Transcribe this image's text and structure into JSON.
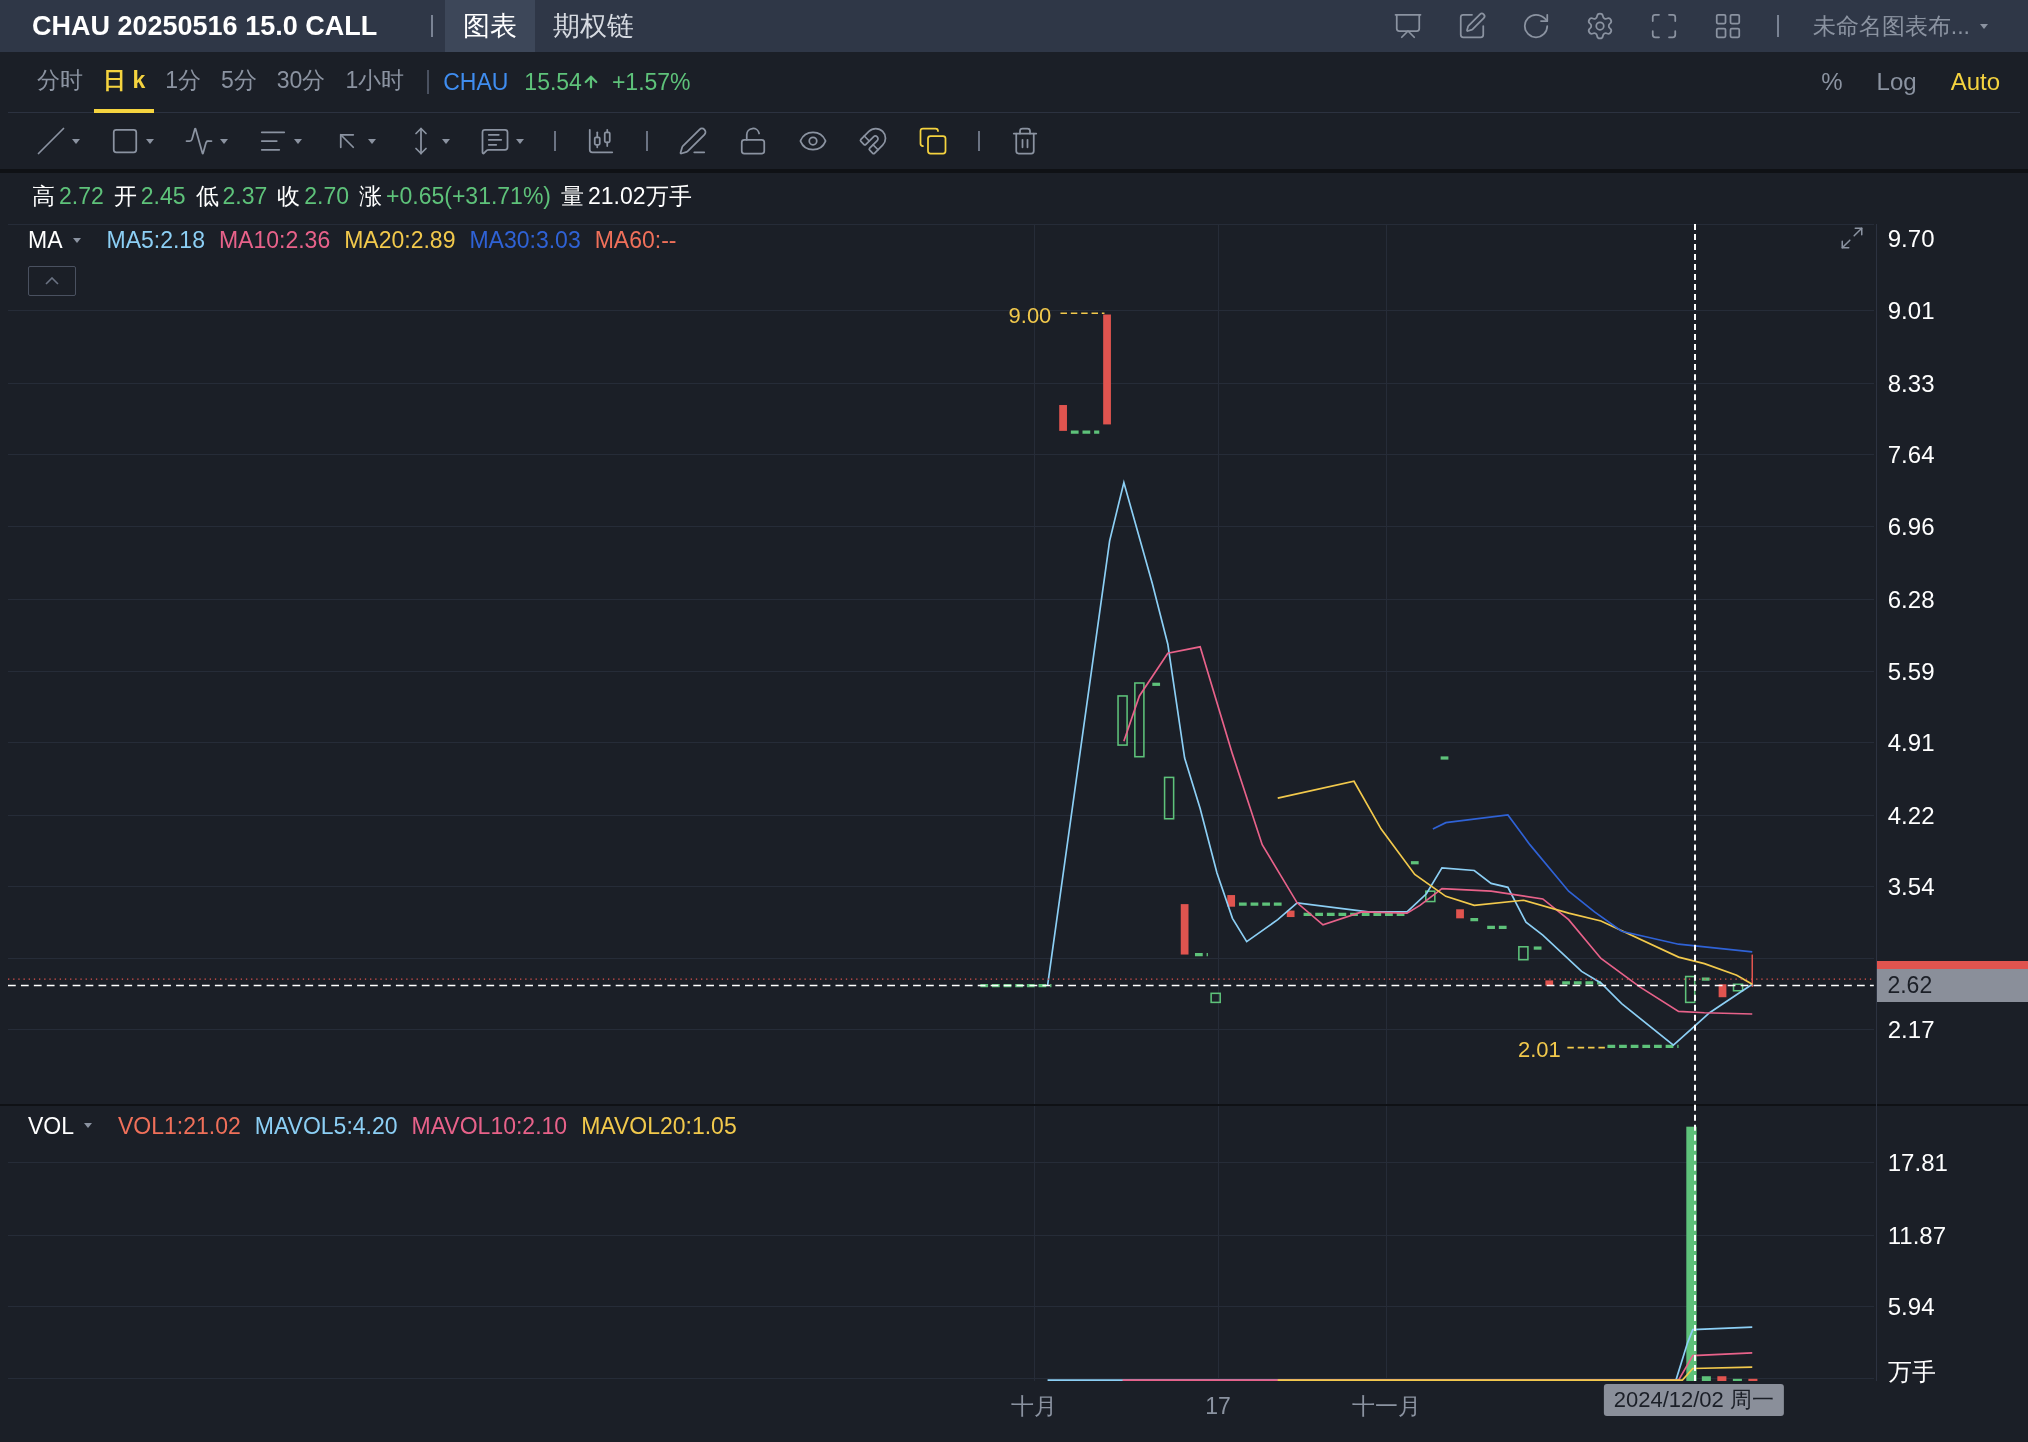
{
  "header": {
    "title": "CHAU 20250516 15.0 CALL",
    "tabs": [
      {
        "label": "图表",
        "selected": true
      },
      {
        "label": "期权链",
        "selected": false
      }
    ],
    "layout_menu": "未命名图表布..."
  },
  "periods": [
    {
      "label": "分时",
      "selected": false
    },
    {
      "label": "日 k",
      "selected": true
    },
    {
      "label": "1分",
      "selected": false
    },
    {
      "label": "5分",
      "selected": false
    },
    {
      "label": "30分",
      "selected": false
    },
    {
      "label": "1小时",
      "selected": false
    }
  ],
  "quote": {
    "symbol": "CHAU",
    "price": "15.54",
    "change": "+1.57%",
    "rising": true
  },
  "scale_options": [
    {
      "label": "%",
      "selected": false
    },
    {
      "label": "Log",
      "selected": false
    },
    {
      "label": "Auto",
      "selected": true
    }
  ],
  "tools": [
    {
      "dropdown": true,
      "active": false
    },
    {
      "dropdown": true,
      "active": false
    },
    {
      "dropdown": true,
      "active": false
    },
    {
      "dropdown": true,
      "active": false
    },
    {
      "dropdown": true,
      "active": false
    },
    {
      "dropdown": true,
      "active": false
    },
    {
      "dropdown": true,
      "active": false
    },
    {
      "dropdown": false,
      "active": false
    },
    {
      "dropdown": false,
      "active": false
    },
    {
      "dropdown": false,
      "active": false
    },
    {
      "dropdown": false,
      "active": false
    },
    {
      "dropdown": false,
      "active": false
    },
    {
      "dropdown": false,
      "active": true
    },
    {
      "dropdown": false,
      "active": false
    }
  ],
  "ohlc": [
    {
      "label": "高",
      "value": "2.72",
      "kind": "price"
    },
    {
      "label": "开",
      "value": "2.45",
      "kind": "price"
    },
    {
      "label": "低",
      "value": "2.37",
      "kind": "price"
    },
    {
      "label": "收",
      "value": "2.70",
      "kind": "price"
    },
    {
      "label": "涨",
      "value": "+0.65(+31.71%)",
      "kind": "price"
    },
    {
      "label": "量",
      "value": "21.02万手",
      "kind": "volume"
    }
  ],
  "ma": {
    "label": "MA",
    "values": [
      {
        "text": "MA5:2.18",
        "color": "#8ccff5"
      },
      {
        "text": "MA10:2.36",
        "color": "#e8628a"
      },
      {
        "text": "MA20:2.89",
        "color": "#f2c94c"
      },
      {
        "text": "MA30:3.03",
        "color": "#2f62d6"
      },
      {
        "text": "MA60:--",
        "color": "#f0705a"
      }
    ]
  },
  "vol": {
    "label": "VOL",
    "values": [
      {
        "text": "VOL1:21.02",
        "color": "#f0705a"
      },
      {
        "text": "MAVOL5:4.20",
        "color": "#8ccff5"
      },
      {
        "text": "MAVOL10:2.10",
        "color": "#e8628a"
      },
      {
        "text": "MAVOL20:1.05",
        "color": "#f2c94c"
      }
    ]
  },
  "price_axis": [
    "9.70",
    "9.01",
    "8.33",
    "7.64",
    "6.96",
    "6.28",
    "5.59",
    "4.91",
    "4.22",
    "3.54",
    "2.17"
  ],
  "current_price": "2.62",
  "high_marker": "9.00",
  "low_marker": "2.01",
  "volume_axis": [
    "17.81",
    "11.87",
    "5.94"
  ],
  "volume_unit": "万手",
  "time_axis": [
    "十月",
    "17",
    "十一月"
  ],
  "crosshair_date": "2024/12/02 周一"
}
